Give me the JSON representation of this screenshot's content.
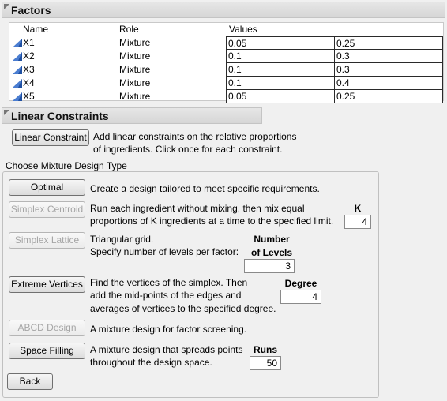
{
  "factors": {
    "title": "Factors",
    "columns": [
      "Name",
      "Role",
      "Values"
    ],
    "rows": [
      {
        "name": "X1",
        "role": "Mixture",
        "low": "0.05",
        "high": "0.25"
      },
      {
        "name": "X2",
        "role": "Mixture",
        "low": "0.1",
        "high": "0.3"
      },
      {
        "name": "X3",
        "role": "Mixture",
        "low": "0.1",
        "high": "0.3"
      },
      {
        "name": "X4",
        "role": "Mixture",
        "low": "0.1",
        "high": "0.4"
      },
      {
        "name": "X5",
        "role": "Mixture",
        "low": "0.05",
        "high": "0.25"
      }
    ]
  },
  "linear_constraints": {
    "title": "Linear Constraints",
    "button": "Linear Constraint",
    "desc_line1": "Add linear constraints on the relative proportions",
    "desc_line2": "of ingredients. Click once for each constraint."
  },
  "design_type": {
    "group_title": "Choose Mixture Design Type",
    "optimal": {
      "button": "Optimal",
      "desc": "Create a design tailored to meet specific requirements."
    },
    "simplex_centroid": {
      "button": "Simplex Centroid",
      "desc_line1": "Run each ingredient without mixing, then mix equal",
      "desc_line2": "proportions of K ingredients at a time to the specified limit.",
      "param_label": "K",
      "param_value": "4"
    },
    "simplex_lattice": {
      "button": "Simplex Lattice",
      "desc_line1": "Triangular grid.",
      "desc_line2": "Specify number of levels per factor:",
      "param_label_line1": "Number",
      "param_label_line2": "of Levels",
      "param_value": "3"
    },
    "extreme_vertices": {
      "button": "Extreme Vertices",
      "desc_line1": "Find the vertices of the simplex. Then",
      "desc_line2": "add the mid-points of the edges and",
      "desc_line3": "averages of vertices to the specified degree.",
      "param_label": "Degree",
      "param_value": "4"
    },
    "abcd": {
      "button": "ABCD Design",
      "desc": "A mixture design for factor screening."
    },
    "space_filling": {
      "button": "Space Filling",
      "desc_line1": "A mixture design that spreads points",
      "desc_line2": "throughout the design space.",
      "param_label": "Runs",
      "param_value": "50"
    }
  },
  "back_button": "Back",
  "colors": {
    "factor_icon": "#1f4fa0",
    "header_bg": "#dcdcdc"
  }
}
